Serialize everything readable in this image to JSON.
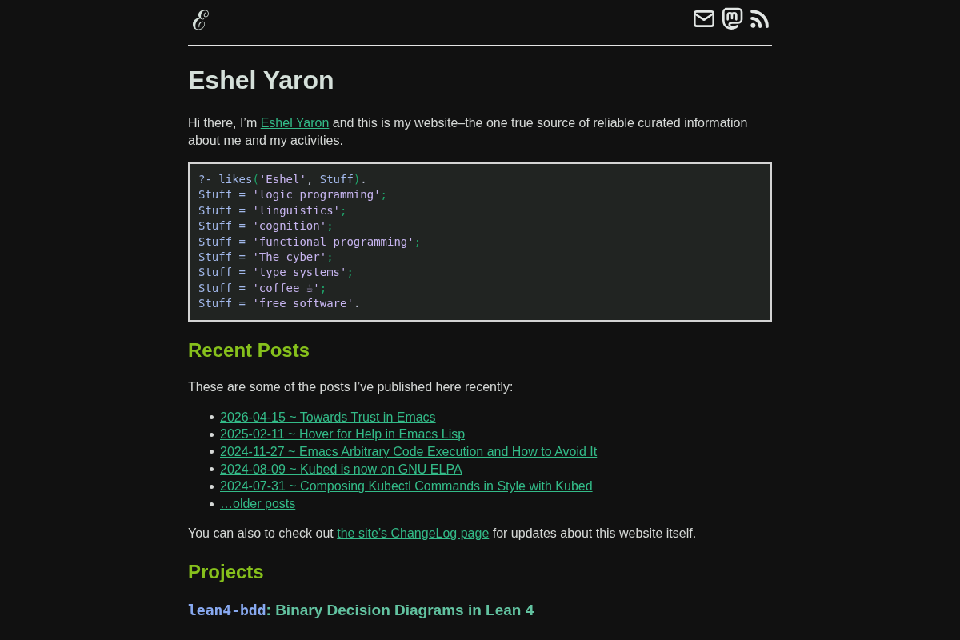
{
  "header": {
    "logo": "ℰ"
  },
  "title": "Eshel Yaron",
  "intro": {
    "before": "Hi there, I’m ",
    "link": "Eshel Yaron",
    "after": " and this is my website–the one true source of reliable curated information about me and my activities."
  },
  "code": {
    "lines": [
      [
        {
          "text": "?- likes",
          "kind": "var"
        },
        {
          "text": "(",
          "kind": "punct"
        },
        {
          "text": "'Eshel'",
          "kind": "string"
        },
        {
          "text": ", ",
          "kind": "plain"
        },
        {
          "text": "Stuff",
          "kind": "var"
        },
        {
          "text": ")",
          "kind": "punct"
        },
        {
          "text": ".",
          "kind": "plain"
        }
      ],
      [
        {
          "text": "Stuff = ",
          "kind": "var"
        },
        {
          "text": "'logic programming'",
          "kind": "string"
        },
        {
          "text": ";",
          "kind": "punct"
        }
      ],
      [
        {
          "text": "Stuff = ",
          "kind": "var"
        },
        {
          "text": "'linguistics'",
          "kind": "string"
        },
        {
          "text": ";",
          "kind": "punct"
        }
      ],
      [
        {
          "text": "Stuff = ",
          "kind": "var"
        },
        {
          "text": "'cognition'",
          "kind": "string"
        },
        {
          "text": ";",
          "kind": "punct"
        }
      ],
      [
        {
          "text": "Stuff = ",
          "kind": "var"
        },
        {
          "text": "'functional programming'",
          "kind": "string"
        },
        {
          "text": ";",
          "kind": "punct"
        }
      ],
      [
        {
          "text": "Stuff = ",
          "kind": "var"
        },
        {
          "text": "'The cyber'",
          "kind": "string"
        },
        {
          "text": ";",
          "kind": "punct"
        }
      ],
      [
        {
          "text": "Stuff = ",
          "kind": "var"
        },
        {
          "text": "'type systems'",
          "kind": "string"
        },
        {
          "text": ";",
          "kind": "punct"
        }
      ],
      [
        {
          "text": "Stuff = ",
          "kind": "var"
        },
        {
          "text": "'coffee ☕'",
          "kind": "string"
        },
        {
          "text": ";",
          "kind": "punct"
        }
      ],
      [
        {
          "text": "Stuff = ",
          "kind": "var"
        },
        {
          "text": "'free software'",
          "kind": "string"
        },
        {
          "text": ".",
          "kind": "plain"
        }
      ]
    ]
  },
  "recent_posts": {
    "heading": "Recent Posts",
    "lead": "These are some of the posts I’ve published here recently:",
    "posts": [
      "2026-04-15 ~ Towards Trust in Emacs",
      "2025-02-11 ~ Hover for Help in Emacs Lisp",
      "2024-11-27 ~ Emacs Arbitrary Code Execution and How to Avoid It",
      "2024-08-09 ~ Kubed is now on GNU ELPA",
      "2024-07-31 ~ Composing Kubectl Commands in Style with Kubed",
      "…older posts"
    ],
    "note": {
      "before": "You can also to check out ",
      "link": "the site’s ChangeLog page",
      "after": " for updates about this website itself."
    }
  },
  "projects": {
    "heading": "Projects",
    "items": [
      {
        "name": "lean4-bdd",
        "title": ": Binary Decision Diagrams in Lean 4"
      }
    ]
  }
}
